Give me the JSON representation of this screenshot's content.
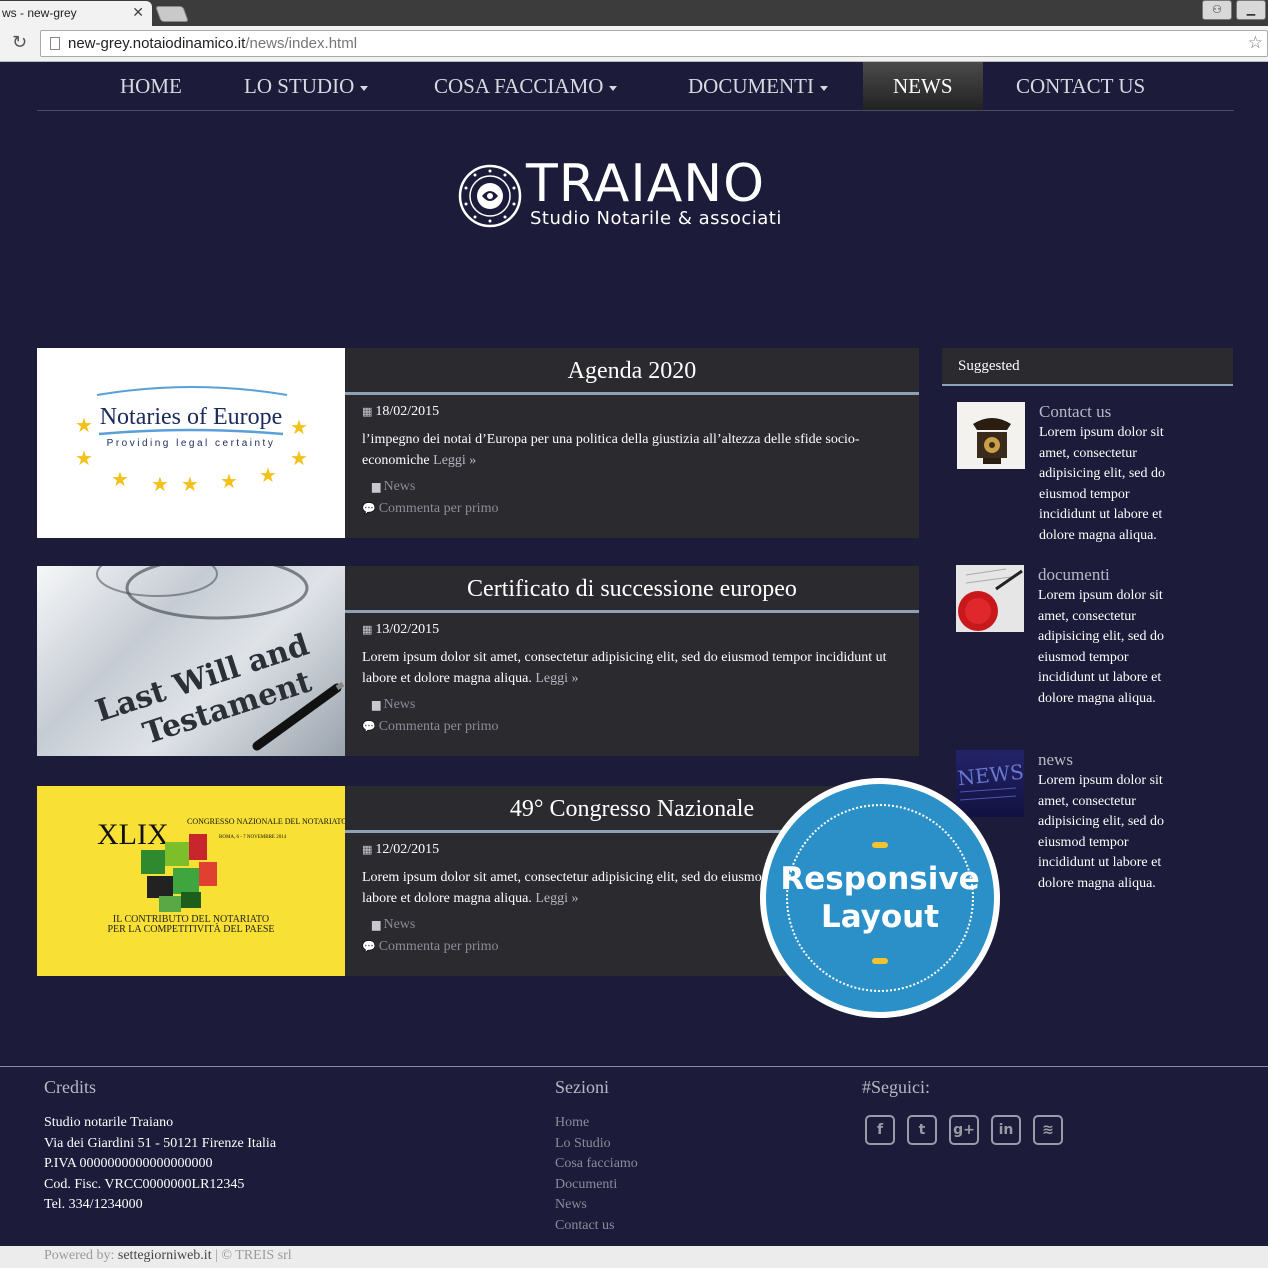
{
  "browser": {
    "tab_title": "ws - new-grey",
    "url_host": "new-grey.notaiodinamico.it",
    "url_path": "/news/index.html"
  },
  "nav": {
    "items": [
      {
        "label": "HOME",
        "dropdown": false
      },
      {
        "label": "LO STUDIO",
        "dropdown": true
      },
      {
        "label": "COSA FACCIAMO",
        "dropdown": true
      },
      {
        "label": "DOCUMENTI",
        "dropdown": true
      },
      {
        "label": "NEWS",
        "dropdown": false,
        "active": true
      },
      {
        "label": "CONTACT US",
        "dropdown": false
      }
    ]
  },
  "logo": {
    "name": "TRAIANO",
    "subtitle": "Studio Notarile & associati",
    "seal_text": "FIDES ET VERITAS ANCHORA"
  },
  "articles": [
    {
      "title": "Agenda 2020",
      "date": "18/02/2015",
      "excerpt": "l’impegno dei notai d’Europa per una politica della giustizia all’altezza delle sfide socio-economiche",
      "read_more": "Leggi »",
      "category": "News",
      "comments": "Commenta per primo",
      "thumb": {
        "title": "Notaries of Europe",
        "tagline": "Providing legal certainty"
      }
    },
    {
      "title": "Certificato di successione europeo",
      "date": "13/02/2015",
      "excerpt": "Lorem ipsum dolor sit amet, consectetur adipisicing elit, sed do eiusmod tempor incididunt ut labore et dolore magna aliqua.",
      "read_more": "Leggi »",
      "category": "News",
      "comments": "Commenta per primo",
      "thumb": {
        "line1": "Last Will and",
        "line2": "Testament"
      }
    },
    {
      "title": "49° Congresso Nazionale",
      "date": "12/02/2015",
      "excerpt": "Lorem ipsum dolor sit amet, consectetur adipisicing elit, sed do eiusmod tempor incididunt ut labore et dolore magna aliqua.",
      "read_more": "Leggi »",
      "category": "News",
      "comments": "Commenta per primo",
      "thumb": {
        "numeral": "XLIX",
        "congress": "CONGRESSO NAZIONALE DEL NOTARIATO",
        "place": "ROMA, 6 - 7 NOVEMBRE 2014",
        "line1": "IL CONTRIBUTO DEL NOTARIATO",
        "line2": "PER LA COMPETITIVITÀ DEL PAESE"
      }
    }
  ],
  "sidebar": {
    "title": "Suggested",
    "items": [
      {
        "title": "Contact us",
        "text": "Lorem ipsum dolor sit amet, consectetur adipisicing elit, sed do eiusmod tempor incididunt ut labore et dolore magna aliqua."
      },
      {
        "title": "documenti",
        "text": "Lorem ipsum dolor sit amet, consectetur adipisicing elit, sed do eiusmod tempor incididunt ut labore et dolore magna aliqua."
      },
      {
        "title": "news",
        "text": "Lorem ipsum dolor sit amet, consectetur adipisicing elit, sed do eiusmod tempor incididunt ut labore et dolore magna aliqua.",
        "thumb_label": "NEWS"
      }
    ]
  },
  "badge": {
    "line1": "Responsive",
    "line2": "Layout"
  },
  "footer": {
    "credits": {
      "title": "Credits",
      "lines": [
        "Studio notarile Traiano",
        "Via dei Giardini 51 - 50121 Firenze Italia",
        "P.IVA 0000000000000000000",
        "Cod. Fisc. VRCC0000000LR12345",
        "Tel. 334/1234000"
      ]
    },
    "sections": {
      "title": "Sezioni",
      "links": [
        "Home",
        "Lo Studio",
        "Cosa facciamo",
        "Documenti",
        "News",
        "Contact us"
      ]
    },
    "social": {
      "title": "#Seguici:",
      "icons": [
        {
          "name": "facebook-icon",
          "glyph": "f"
        },
        {
          "name": "twitter-icon",
          "glyph": "t"
        },
        {
          "name": "google-plus-icon",
          "glyph": "g+"
        },
        {
          "name": "linkedin-icon",
          "glyph": "in"
        },
        {
          "name": "rss-icon",
          "glyph": "≋"
        }
      ]
    }
  },
  "bottom": {
    "powered_by": "Powered by:",
    "powered_link": "settegiorniweb.it",
    "copyright": "| © TREIS srl"
  },
  "colors": {
    "page_bg": "#1c1b39",
    "panel_bg": "#2b2a2f",
    "accent_line": "#8ea1b6",
    "badge_blue": "#2b8fc8",
    "badge_gold": "#f2c230"
  }
}
